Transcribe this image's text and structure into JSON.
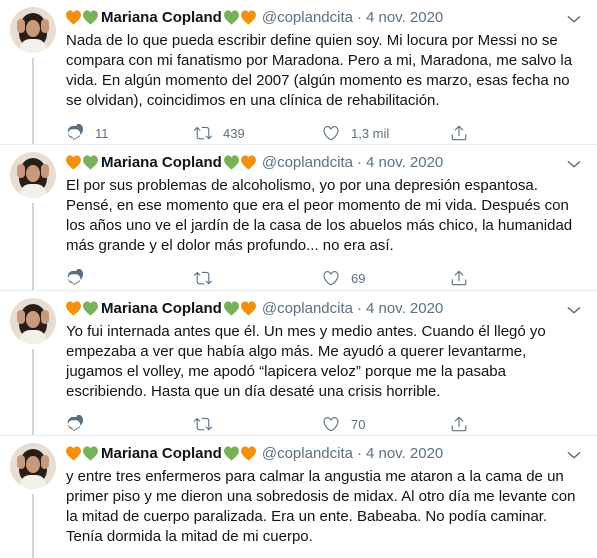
{
  "author": {
    "display_name": "Mariana Copland",
    "handle": "@coplandcita",
    "emoji_colors": {
      "orange": "#f4900c",
      "green": "#78b159"
    }
  },
  "tweets": [
    {
      "date": "4 nov. 2020",
      "text": "Nada de lo que pueda escribir define quien soy. Mi locura por Messi no se compara con mi fanatismo por Maradona. Pero a mi, Maradona, me salvo la vida. En algún momento del 2007 (algún momento es marzo, esas fecha no se olvidan), coincidimos en una clínica de rehabilitación.",
      "replies": "11",
      "retweets": "439",
      "likes": "1,3 mil"
    },
    {
      "date": "4 nov. 2020",
      "text": "El por sus problemas de alcoholismo, yo por una depresión espantosa. Pensé, en ese momento que era el peor momento de mi vida. Después con los años uno ve el jardín de la casa de los abuelos más chico, la humanidad más grande y el dolor más profundo... no era así.",
      "replies": "",
      "retweets": "",
      "likes": "69"
    },
    {
      "date": "4 nov. 2020",
      "text": "Yo fui internada antes que él. Un mes y medio antes. Cuando él llegó yo empezaba a ver que había algo más. Me ayudó a querer levantarme, jugamos el volley, me apodó “lapicera veloz” porque me la pasaba escribiendo. Hasta que un día desaté una crisis horrible.",
      "replies": "",
      "retweets": "",
      "likes": "70"
    },
    {
      "date": "4 nov. 2020",
      "text": "y entre tres enfermeros para calmar la angustia me ataron a la cama de un primer piso y me dieron una sobredosis de midax. Al otro día me levante con la mitad de cuerpo paralizada. Era un ente. Babeaba. No podía caminar. Tenía dormida la mitad de mi cuerpo."
    }
  ],
  "separator": "·",
  "icons": [
    "avatar",
    "orange-heart-icon",
    "green-heart-icon",
    "chevron-down-icon",
    "reply-icon",
    "retweet-icon",
    "like-icon",
    "share-icon"
  ]
}
